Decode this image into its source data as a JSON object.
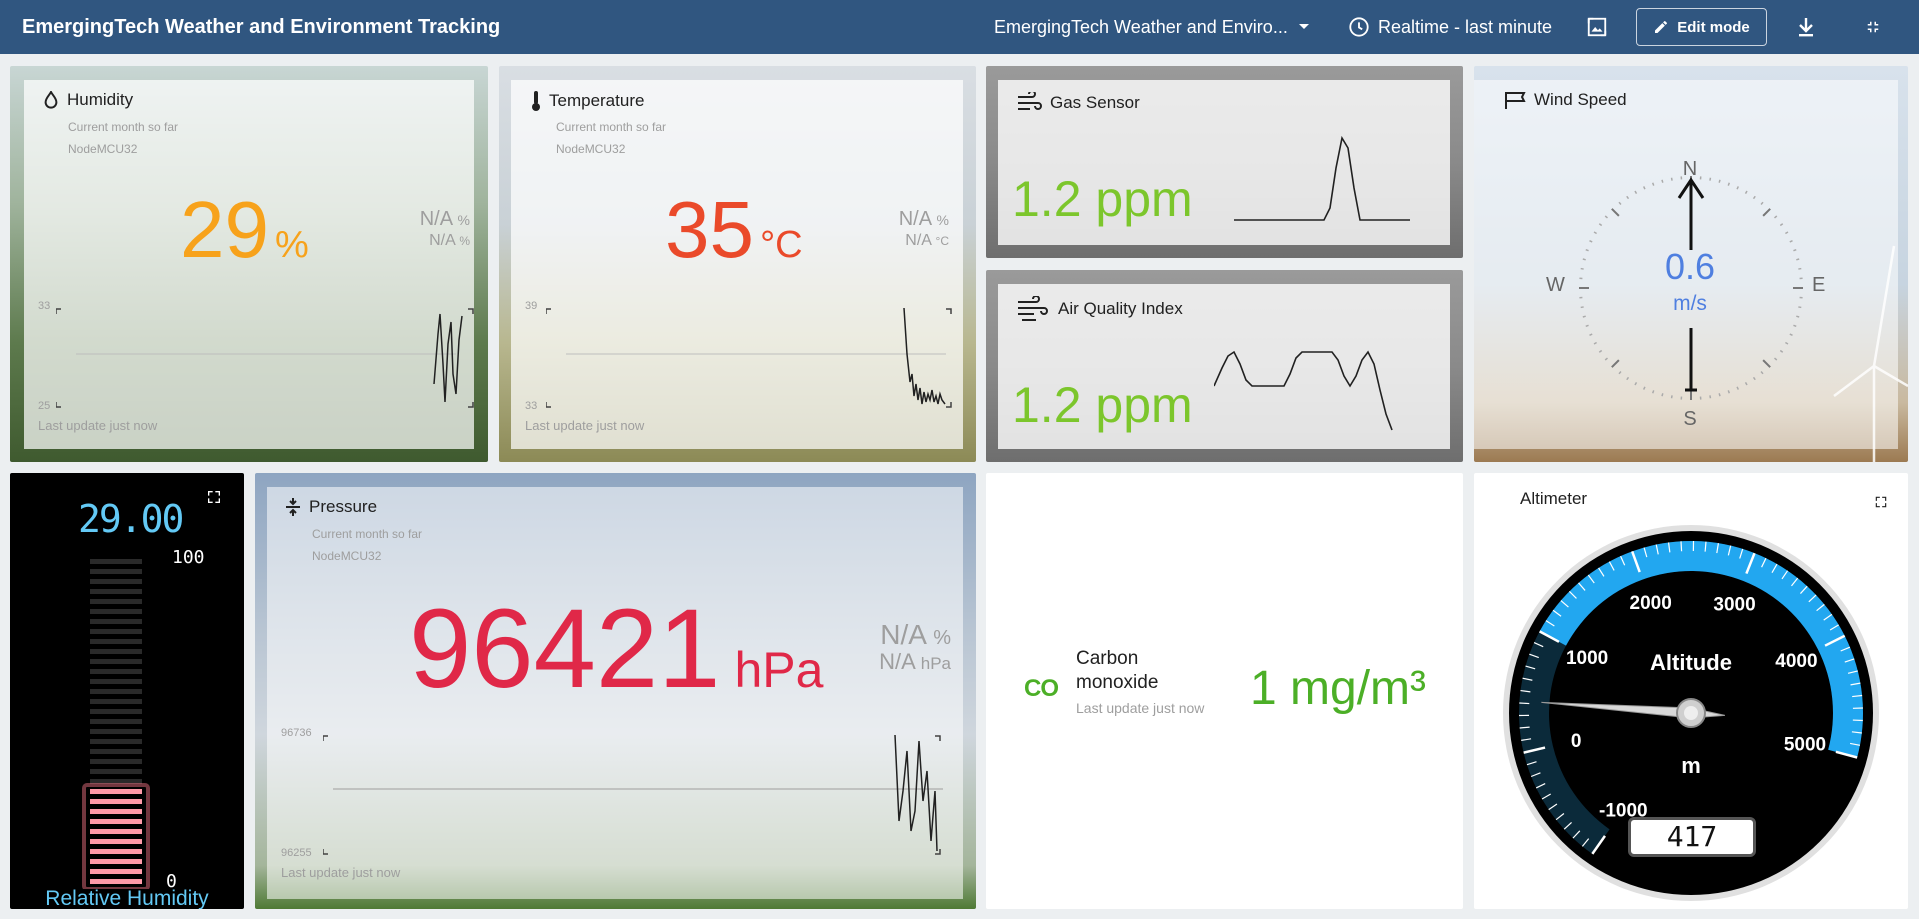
{
  "app": {
    "title": "EmergingTech Weather and Environment Tracking",
    "dashboard_select": "EmergingTech Weather and Enviro...",
    "time_window": "Realtime - last minute",
    "edit_label": "Edit mode"
  },
  "humidity": {
    "title": "Humidity",
    "subtitle": "Current month so far",
    "device": "NodeMCU32",
    "value": "29",
    "unit": "%",
    "na1": "N/A",
    "na1_unit": "%",
    "na2": "N/A",
    "na2_unit": "%",
    "axis_max": "33",
    "axis_min": "25",
    "last_update": "Last update just now",
    "color": "#f7a21b"
  },
  "temperature": {
    "title": "Temperature",
    "subtitle": "Current month so far",
    "device": "NodeMCU32",
    "value": "35",
    "unit": "°C",
    "na1": "N/A",
    "na1_unit": "%",
    "na2": "N/A",
    "na2_unit": "°C",
    "axis_max": "39",
    "axis_min": "33",
    "last_update": "Last update just now",
    "color": "#ea4a2a"
  },
  "gas": {
    "title": "Gas Sensor",
    "value": "1.2 ppm",
    "color": "#7cc62c"
  },
  "aqi": {
    "title": "Air Quality Index",
    "value": "1.2 ppm",
    "color": "#7cc62c"
  },
  "wind": {
    "title": "Wind Speed",
    "value": "0.6",
    "unit": "m/s",
    "n": "N",
    "s": "S",
    "e": "E",
    "w": "W",
    "color": "#4f7fe0"
  },
  "rh_gauge": {
    "top_value": "29.00",
    "max": "100",
    "min": "0",
    "label": "Relative Humidity",
    "level_fraction": 0.29,
    "color": "#63c9f5"
  },
  "pressure": {
    "title": "Pressure",
    "subtitle": "Current month so far",
    "device": "NodeMCU32",
    "value": "96421",
    "unit": "hPa",
    "na1": "N/A",
    "na1_unit": "%",
    "na2": "N/A",
    "na2_unit": "hPa",
    "axis_max": "96736",
    "axis_min": "96255",
    "last_update": "Last update just now",
    "color": "#e02848"
  },
  "co": {
    "icon_text": "CO",
    "title": "Carbon monoxide",
    "last_update": "Last update just now",
    "value": "1 mg/m³",
    "color": "#4caf27"
  },
  "altimeter": {
    "title": "Altimeter",
    "gauge_label": "Altitude",
    "unit": "m",
    "ticks": [
      "-1000",
      "0",
      "1000",
      "2000",
      "3000",
      "4000",
      "5000"
    ],
    "value": 417,
    "display": "417",
    "accent": "#22a7f0"
  }
}
